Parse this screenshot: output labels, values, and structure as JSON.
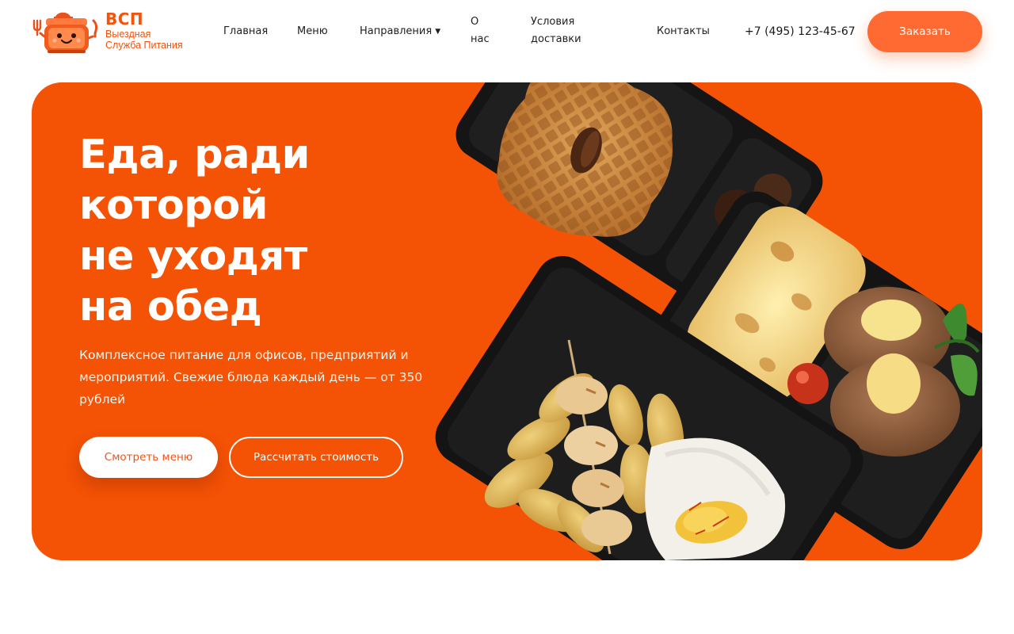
{
  "brand": {
    "name": "ВСП",
    "subtitle_line1": "Выездная",
    "subtitle_line2": "Служба Питания",
    "color": "#f5520b"
  },
  "nav": {
    "home": "Главная",
    "menu": "Меню",
    "directions": "Направления",
    "about_line1": "О",
    "about_line2": "нас",
    "delivery_line1": "Условия",
    "delivery_line2": "доставки",
    "contacts": "Контакты",
    "dropdown_icon": "chevron-down-icon"
  },
  "header": {
    "phone": "+7 (495) 123-45-67",
    "order_button": "Заказать",
    "accent": "#ff6a32"
  },
  "hero": {
    "title_lines": [
      "Еда, ради",
      "которой",
      "не уходят",
      "на обед"
    ],
    "description": "Комплексное питание для офисов, предприятий и мероприятий. Свежие блюда каждый день — от 350 рублей",
    "primary_button": "Смотреть меню",
    "secondary_button": "Рассчитать стоимость",
    "background": "#f45205",
    "image": "food-containers-photo"
  }
}
